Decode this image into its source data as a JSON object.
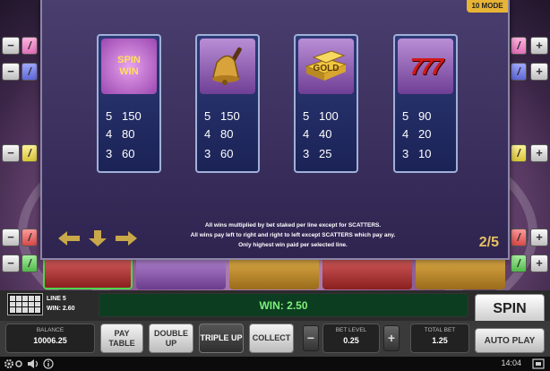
{
  "mode_tab": "10 MODE",
  "paytable": {
    "symbols": [
      {
        "name": "spin-win",
        "art_text": "SPIN WIN",
        "pays": [
          {
            "count": "5",
            "value": "150"
          },
          {
            "count": "4",
            "value": "80"
          },
          {
            "count": "3",
            "value": "60"
          }
        ]
      },
      {
        "name": "bell",
        "art_text": "",
        "pays": [
          {
            "count": "5",
            "value": "150"
          },
          {
            "count": "4",
            "value": "80"
          },
          {
            "count": "3",
            "value": "60"
          }
        ]
      },
      {
        "name": "gold",
        "art_text": "GOLD",
        "pays": [
          {
            "count": "5",
            "value": "100"
          },
          {
            "count": "4",
            "value": "40"
          },
          {
            "count": "3",
            "value": "25"
          }
        ]
      },
      {
        "name": "sevens",
        "art_text": "777",
        "pays": [
          {
            "count": "5",
            "value": "90"
          },
          {
            "count": "4",
            "value": "20"
          },
          {
            "count": "3",
            "value": "10"
          }
        ]
      }
    ],
    "rules": [
      "All wins multiplied by bet staked per line except for SCATTERS.",
      "All wins pay left to right and right to left except SCATTERS which pay any.",
      "Only highest win paid per selected line."
    ],
    "page_indicator": "2/5"
  },
  "line_info": {
    "lines": "LINE 5",
    "win": "WIN: 2.60"
  },
  "win_display": "WIN: 2.50",
  "spin_label": "SPIN",
  "controls": {
    "balance_label": "BALANCE",
    "balance_value": "10006.25",
    "paytable_label": "PAY TABLE",
    "double_up_label": "DOUBLE UP",
    "triple_up_label": "TRIPLE UP",
    "collect_label": "COLLECT",
    "minus": "−",
    "bet_level_label": "BET LEVEL",
    "bet_level_value": "0.25",
    "plus": "+",
    "total_bet_label": "TOTAL BET",
    "total_bet_value": "1.25",
    "auto_play_label": "AUTO PLAY"
  },
  "status": {
    "time": "14:04"
  },
  "colors": {
    "win_text": "#7cf07a",
    "page_indicator": "#e8c060",
    "accent": "#e7b436"
  }
}
